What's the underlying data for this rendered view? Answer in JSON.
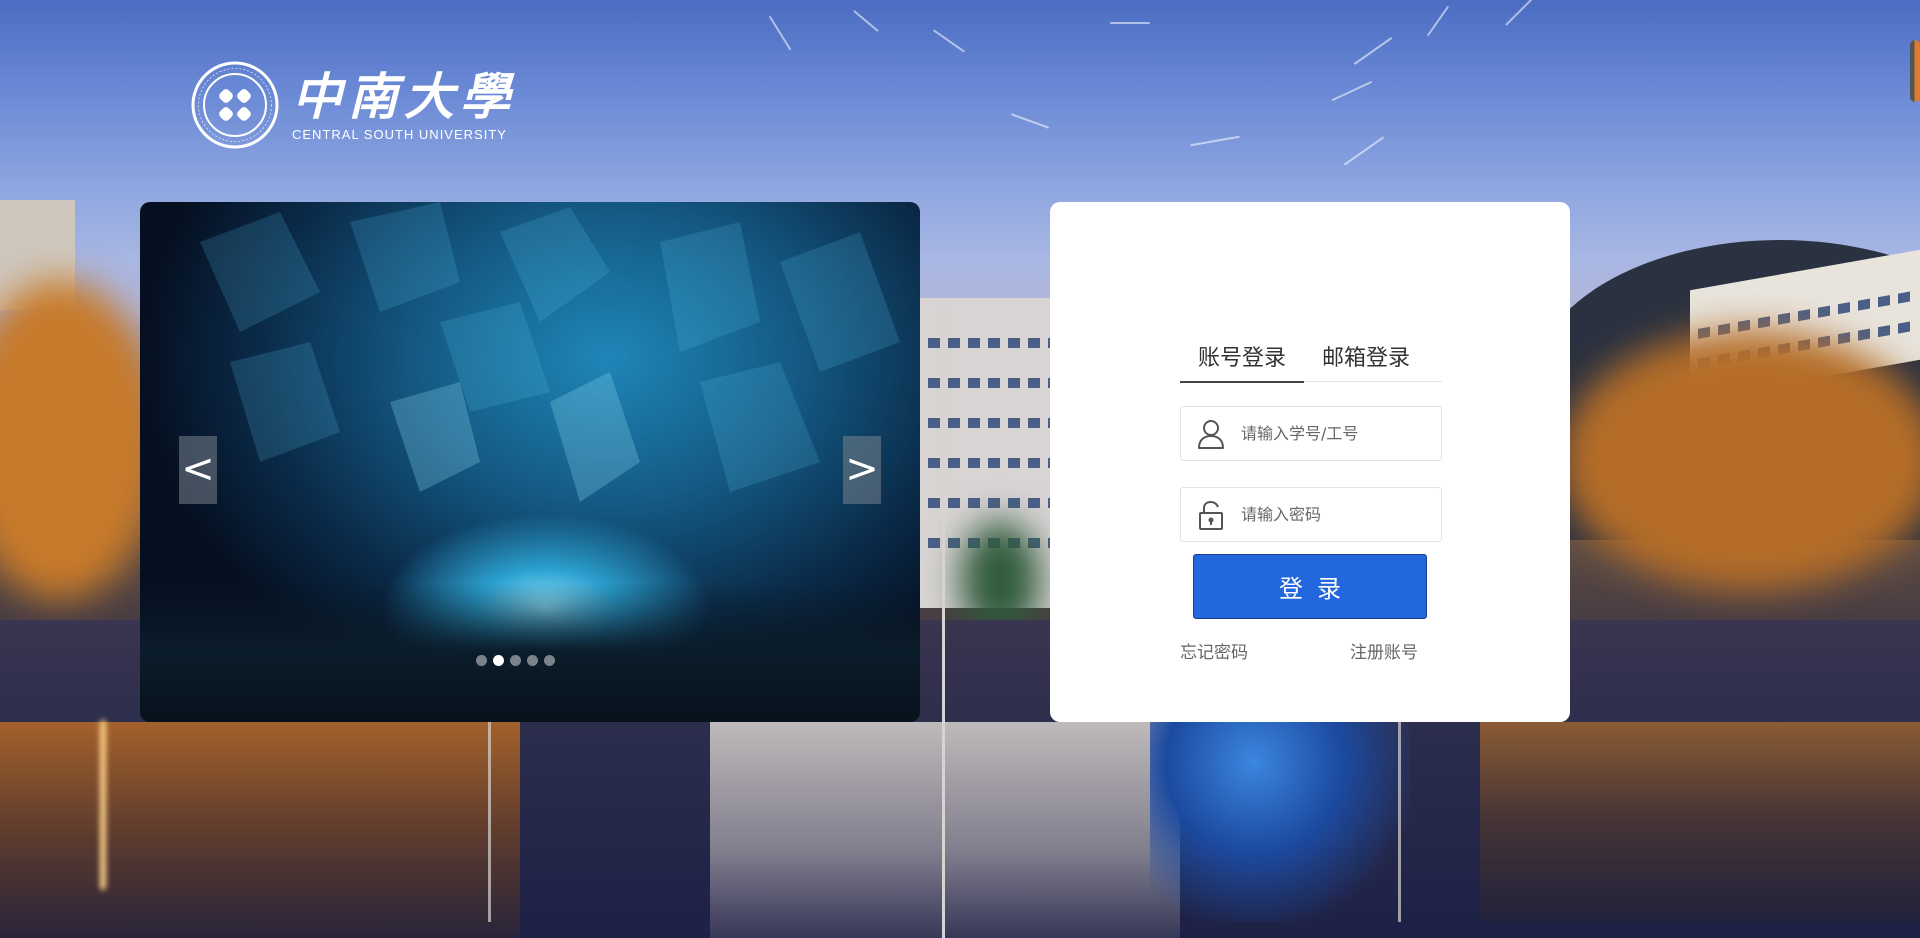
{
  "logo": {
    "cn": "中南大學",
    "en": "CENTRAL SOUTH UNIVERSITY",
    "emblem_ring_text": "CENTRAL SOUTH UNIVERSITY"
  },
  "carousel": {
    "prev_label": "<",
    "next_label": ">",
    "slide_count": 5,
    "active_index": 1
  },
  "login": {
    "tabs": [
      {
        "label": "账号登录",
        "active": true
      },
      {
        "label": "邮箱登录",
        "active": false
      }
    ],
    "username_placeholder": "请输入学号/工号",
    "password_placeholder": "请输入密码",
    "submit_label": "登录",
    "forgot_label": "忘记密码",
    "register_label": "注册账号"
  },
  "colors": {
    "accent": "#2367df",
    "card_bg": "#ffffff",
    "scroll_thumb": "#e07a2c"
  },
  "icons": {
    "user": "user-icon",
    "lock": "lock-icon"
  }
}
